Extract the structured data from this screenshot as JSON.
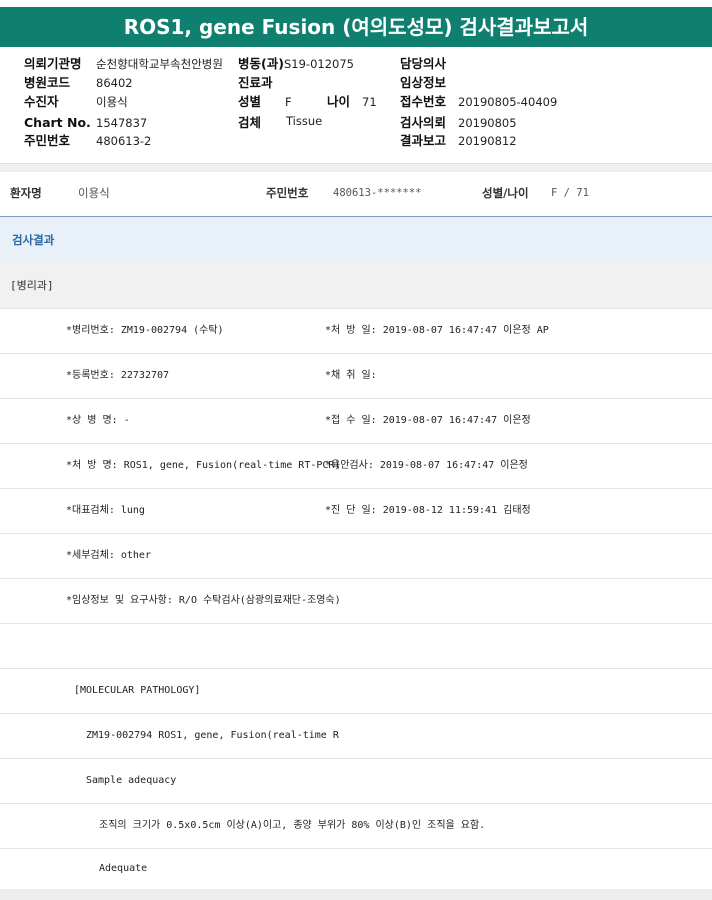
{
  "title": "ROS1, gene Fusion (여의도성모) 검사결과보고서",
  "header": {
    "institution_label": "의뢰기관명",
    "institution_value": "순천향대학교부속천안병원",
    "dept_label": "병동(과)",
    "dept_value": "S19-012075",
    "doctor_label": "담당의사",
    "hospital_code_label": "병원코드",
    "hospital_code_value": "86402",
    "clinic_label": "진료과",
    "clinical_info_label": "임상정보",
    "collector_label": "수진자",
    "collector_value": "이용식",
    "sex_label": "성별",
    "sex_value": "F",
    "age_label": "나이",
    "age_value": "71",
    "reception_no_label": "접수번호",
    "reception_no_value": "20190805-40409",
    "chart_no_label": "Chart No.",
    "chart_no_value": "1547837",
    "specimen_label": "검체",
    "specimen_value": "Tissue",
    "request_label": "검사의뢰",
    "request_value": "20190805",
    "resident_no_label": "주민번호",
    "resident_no_value": "480613-2",
    "report_label": "결과보고",
    "report_value": "20190812"
  },
  "patient": {
    "name_label": "환자명",
    "name_value": "이용식",
    "id_label": "주민번호",
    "id_value": "480613-*******",
    "sexage_label": "성별/나이",
    "sexage_value": "F / 71"
  },
  "result_tab": "검사결과",
  "department": "[병리과]",
  "rows": [
    {
      "left": "*병리번호: ZM19-002794 (수탁)",
      "right": "*처 방 일: 2019-08-07 16:47:47  이은정 AP"
    },
    {
      "left": "*등록번호: 22732707",
      "right": "*채 취 일:"
    },
    {
      "left": "*상 병 명: -",
      "right": "*접 수 일: 2019-08-07 16:47:47  이은정"
    },
    {
      "left": "*처 방 명: ROS1, gene, Fusion(real-time RT-PCR)",
      "right": "*육안검사: 2019-08-07 16:47:47  이은정"
    },
    {
      "left": "*대표검체: lung",
      "right": "*진 단 일: 2019-08-12 11:59:41  김태정"
    },
    {
      "left": "*세부검체: other",
      "right": ""
    },
    {
      "left": "*임상정보 및 요구사항: R/O 수탁검사(삼광의료재단-조영숙)",
      "right": ""
    }
  ],
  "report": {
    "section": "[MOLECULAR PATHOLOGY]",
    "id_line": "ZM19-002794     ROS1, gene, Fusion(real-time R",
    "adequacy_label": "Sample adequacy",
    "criteria": "조직의 크기가 0.5x0.5cm 이상(A)이고, 종양 부위가 80% 이상(B)인 조직을 요함.",
    "adequacy_value": "Adequate"
  }
}
